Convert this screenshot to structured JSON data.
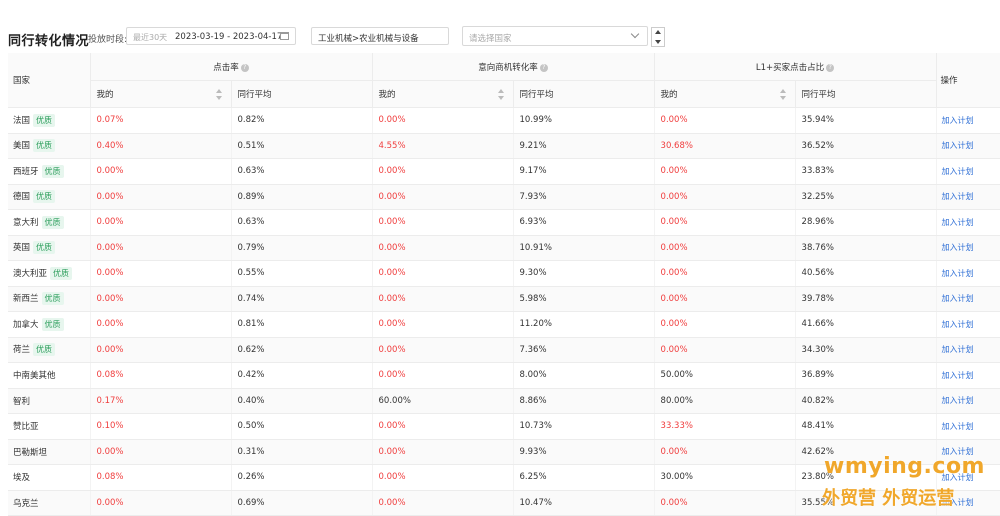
{
  "toolbar": {
    "title": "同行转化情况",
    "date_label": "投放时段:",
    "date_preset": "最近30天",
    "date_range": "2023-03-19 - 2023-04-17",
    "category": "工业机械>农业机械与设备",
    "country_placeholder": "请选择国家"
  },
  "table": {
    "country_header": "国家",
    "action_header": "操作",
    "groups": [
      "点击率",
      "意向商机转化率",
      "L1+买家点击占比"
    ],
    "sub_mine": "我的",
    "sub_avg": "同行平均",
    "badge": "优质",
    "action_label": "加入计划",
    "rows": [
      {
        "country": "法国",
        "badge": true,
        "v": [
          "0.07%",
          "0.82%",
          "0.00%",
          "10.99%",
          "0.00%",
          "35.94%"
        ],
        "red": [
          true,
          false,
          true,
          false,
          true,
          false
        ]
      },
      {
        "country": "美国",
        "badge": true,
        "v": [
          "0.40%",
          "0.51%",
          "4.55%",
          "9.21%",
          "30.68%",
          "36.52%"
        ],
        "red": [
          true,
          false,
          true,
          false,
          true,
          false
        ]
      },
      {
        "country": "西班牙",
        "badge": true,
        "v": [
          "0.00%",
          "0.63%",
          "0.00%",
          "9.17%",
          "0.00%",
          "33.83%"
        ],
        "red": [
          true,
          false,
          true,
          false,
          true,
          false
        ]
      },
      {
        "country": "德国",
        "badge": true,
        "v": [
          "0.00%",
          "0.89%",
          "0.00%",
          "7.93%",
          "0.00%",
          "32.25%"
        ],
        "red": [
          true,
          false,
          true,
          false,
          true,
          false
        ]
      },
      {
        "country": "意大利",
        "badge": true,
        "v": [
          "0.00%",
          "0.63%",
          "0.00%",
          "6.93%",
          "0.00%",
          "28.96%"
        ],
        "red": [
          true,
          false,
          true,
          false,
          true,
          false
        ]
      },
      {
        "country": "英国",
        "badge": true,
        "v": [
          "0.00%",
          "0.79%",
          "0.00%",
          "10.91%",
          "0.00%",
          "38.76%"
        ],
        "red": [
          true,
          false,
          true,
          false,
          true,
          false
        ]
      },
      {
        "country": "澳大利亚",
        "badge": true,
        "v": [
          "0.00%",
          "0.55%",
          "0.00%",
          "9.30%",
          "0.00%",
          "40.56%"
        ],
        "red": [
          true,
          false,
          true,
          false,
          true,
          false
        ]
      },
      {
        "country": "新西兰",
        "badge": true,
        "v": [
          "0.00%",
          "0.74%",
          "0.00%",
          "5.98%",
          "0.00%",
          "39.78%"
        ],
        "red": [
          true,
          false,
          true,
          false,
          true,
          false
        ]
      },
      {
        "country": "加拿大",
        "badge": true,
        "v": [
          "0.00%",
          "0.81%",
          "0.00%",
          "11.20%",
          "0.00%",
          "41.66%"
        ],
        "red": [
          true,
          false,
          true,
          false,
          true,
          false
        ]
      },
      {
        "country": "荷兰",
        "badge": true,
        "v": [
          "0.00%",
          "0.62%",
          "0.00%",
          "7.36%",
          "0.00%",
          "34.30%"
        ],
        "red": [
          true,
          false,
          true,
          false,
          true,
          false
        ]
      },
      {
        "country": "中南美其他",
        "badge": false,
        "v": [
          "0.08%",
          "0.42%",
          "0.00%",
          "8.00%",
          "50.00%",
          "36.89%"
        ],
        "red": [
          true,
          false,
          true,
          false,
          false,
          false
        ]
      },
      {
        "country": "智利",
        "badge": false,
        "v": [
          "0.17%",
          "0.40%",
          "60.00%",
          "8.86%",
          "80.00%",
          "40.82%"
        ],
        "red": [
          true,
          false,
          false,
          false,
          false,
          false
        ]
      },
      {
        "country": "赞比亚",
        "badge": false,
        "v": [
          "0.10%",
          "0.50%",
          "0.00%",
          "10.73%",
          "33.33%",
          "48.41%"
        ],
        "red": [
          true,
          false,
          true,
          false,
          true,
          false
        ]
      },
      {
        "country": "巴勒斯坦",
        "badge": false,
        "v": [
          "0.00%",
          "0.31%",
          "0.00%",
          "9.93%",
          "0.00%",
          "42.62%"
        ],
        "red": [
          true,
          false,
          true,
          false,
          true,
          false
        ]
      },
      {
        "country": "埃及",
        "badge": false,
        "v": [
          "0.08%",
          "0.26%",
          "0.00%",
          "6.25%",
          "30.00%",
          "23.80%"
        ],
        "red": [
          true,
          false,
          true,
          false,
          false,
          false
        ]
      },
      {
        "country": "乌克兰",
        "badge": false,
        "v": [
          "0.00%",
          "0.69%",
          "0.00%",
          "10.47%",
          "0.00%",
          "35.55%"
        ],
        "red": [
          true,
          false,
          true,
          false,
          true,
          false
        ]
      }
    ]
  },
  "watermark": {
    "line1": "wmying.com",
    "line2": "外贸营 外贸运营"
  }
}
